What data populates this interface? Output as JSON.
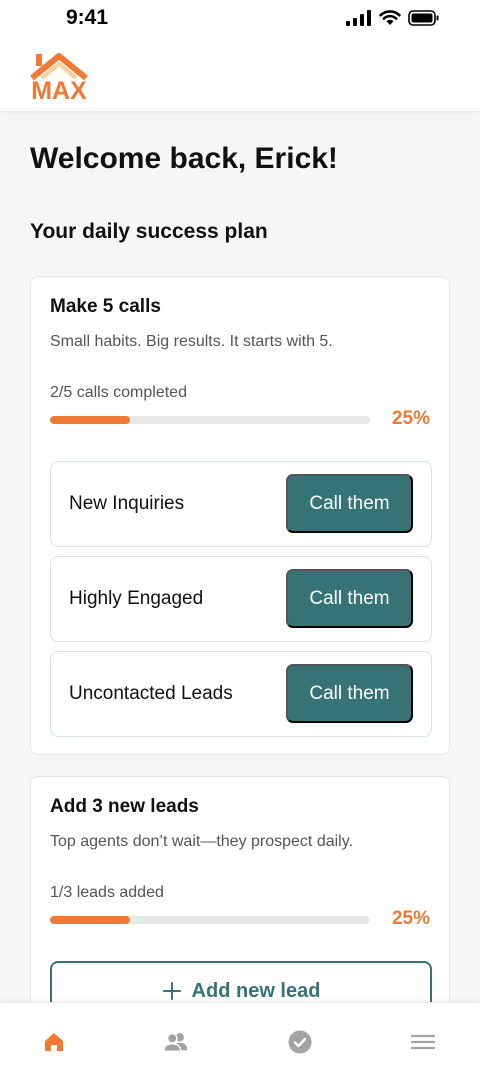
{
  "status_bar": {
    "time": "9:41"
  },
  "header": {
    "logo_text": "MAX"
  },
  "main": {
    "welcome": "Welcome back, Erick!",
    "section_title": "Your daily success plan",
    "calls_card": {
      "title": "Make 5 calls",
      "subtitle": "Small habits. Big results. It starts with 5.",
      "progress_label": "2/5 calls completed",
      "progress_percent_text": "25%",
      "progress_fraction": 0.25,
      "rows": [
        {
          "label": "New Inquiries",
          "button": "Call them"
        },
        {
          "label": "Highly Engaged",
          "button": "Call them"
        },
        {
          "label": "Uncontacted Leads",
          "button": "Call them"
        }
      ]
    },
    "leads_card": {
      "title": "Add 3 new leads",
      "subtitle": "Top agents don’t wait—they prospect daily.",
      "progress_label": "1/3 leads added",
      "progress_percent_text": "25%",
      "progress_fraction": 0.25,
      "add_button": "Add new lead"
    }
  },
  "bottom_nav": {
    "items": [
      {
        "icon": "home-icon",
        "active": true
      },
      {
        "icon": "contacts-icon",
        "active": false
      },
      {
        "icon": "check-circle-icon",
        "active": false
      },
      {
        "icon": "menu-icon",
        "active": false
      }
    ]
  },
  "colors": {
    "accent": "#f07a35",
    "primary": "#357377",
    "background": "#f6f6f6",
    "inactive_icon": "#a3a3a3"
  }
}
